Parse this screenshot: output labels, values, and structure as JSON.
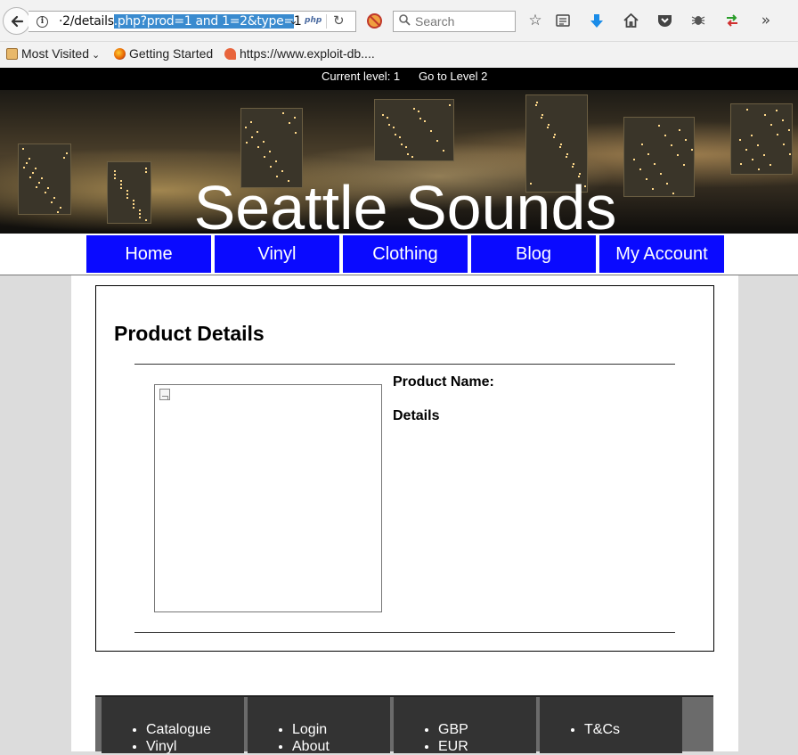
{
  "browser": {
    "url_prefix": "·2/details",
    "url_selected": ".php?prod=1 and 1=2&type=",
    "url_suffix": "1",
    "url_badge": "php",
    "search_placeholder": "Search",
    "bookmarks": [
      "Most Visited",
      "Getting Started",
      "https://www.exploit-db...."
    ]
  },
  "topbar": {
    "current_level": "Current level: 1",
    "next_level_link": "Go to Level 2"
  },
  "site": {
    "title": "Seattle Sounds"
  },
  "nav": {
    "items": [
      "Home",
      "Vinyl",
      "Clothing",
      "Blog",
      "My Account"
    ]
  },
  "product": {
    "heading": "Product Details",
    "name_label": "Product Name:",
    "details_label": "Details"
  },
  "footer": {
    "columns": [
      [
        "Catalogue",
        "Vinyl"
      ],
      [
        "Login",
        "About"
      ],
      [
        "GBP",
        "EUR"
      ],
      [
        "T&Cs"
      ]
    ]
  },
  "colors": {
    "nav_bg": "#0a0aff",
    "topbar_bg": "#000000",
    "footer_col_bg": "#333333",
    "page_bg": "#dcdcdc"
  }
}
